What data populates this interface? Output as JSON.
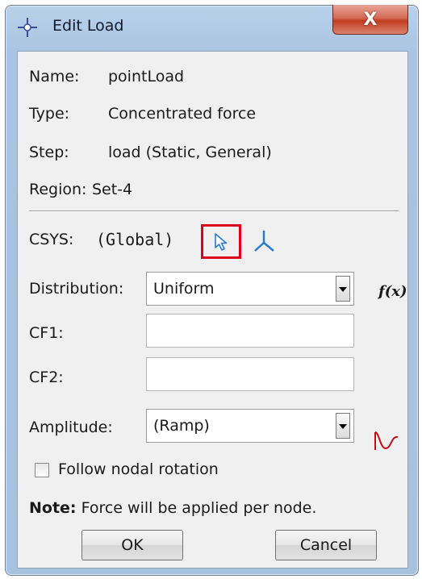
{
  "window": {
    "title": "Edit Load",
    "close_label": "X"
  },
  "info": {
    "name_label": "Name:",
    "name_value": "pointLoad",
    "type_label": "Type:",
    "type_value": "Concentrated force",
    "step_label": "Step:",
    "step_value": "load (Static, General)",
    "region_label": "Region:",
    "region_value": "Set-4"
  },
  "csys": {
    "label": "CSYS:",
    "value": "(Global)",
    "pick_icon": "arrow-pointer-icon",
    "datum_icon": "csys-triad-icon",
    "highlight_color": "#e0001b"
  },
  "distribution": {
    "label": "Distribution:",
    "selected": "Uniform",
    "fx_label": "f(x)"
  },
  "cf1": {
    "label": "CF1:",
    "value": ""
  },
  "cf2": {
    "label": "CF2:",
    "value": ""
  },
  "amplitude": {
    "label": "Amplitude:",
    "selected": "(Ramp)",
    "icon": "amplitude-curve-icon",
    "icon_color": "#c0111a"
  },
  "follow_nodal": {
    "label": "Follow nodal rotation",
    "checked": false
  },
  "note": {
    "prefix": "Note:",
    "text": "Force will be applied per node."
  },
  "buttons": {
    "ok": "OK",
    "cancel": "Cancel"
  }
}
